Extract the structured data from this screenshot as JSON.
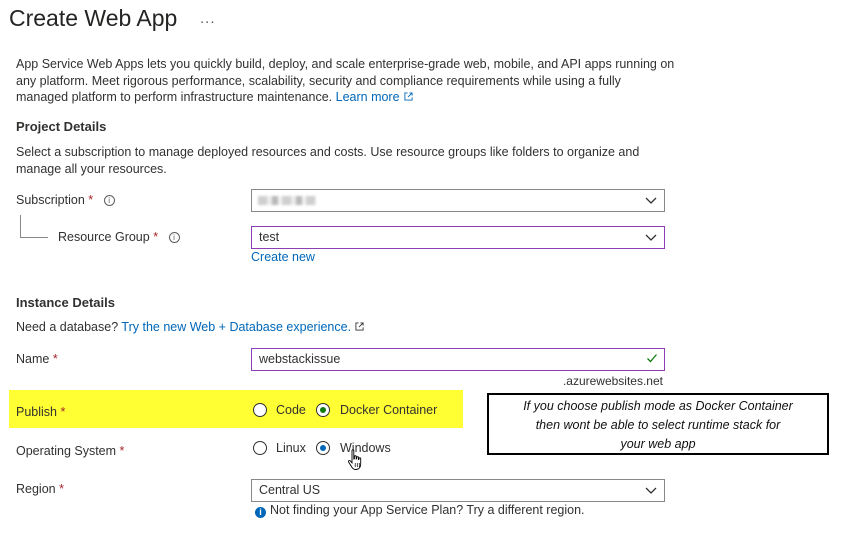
{
  "page": {
    "title": "Create Web App",
    "more_menu": "...",
    "intro": "App Service Web Apps lets you quickly build, deploy, and scale enterprise-grade web, mobile, and API apps running on any platform. Meet rigorous performance, scalability, security and compliance requirements while using a fully managed platform to perform infrastructure maintenance.",
    "learn_more": "Learn more"
  },
  "project": {
    "heading": "Project Details",
    "description": "Select a subscription to manage deployed resources and costs. Use resource groups like folders to organize and manage all your resources.",
    "subscription_label": "Subscription",
    "subscription_value": "",
    "resource_group_label": "Resource Group",
    "resource_group_value": "test",
    "create_new": "Create new"
  },
  "instance": {
    "heading": "Instance Details",
    "db_prompt": "Need a database?",
    "db_link": "Try the new Web + Database experience.",
    "name_label": "Name",
    "name_value": "webstackissue",
    "name_suffix": ".azurewebsites.net",
    "publish_label": "Publish",
    "publish_options": [
      "Code",
      "Docker Container"
    ],
    "publish_selected": "Docker Container",
    "os_label": "Operating System",
    "os_options": [
      "Linux",
      "Windows"
    ],
    "os_selected": "Windows",
    "region_label": "Region",
    "region_value": "Central US",
    "region_hint": "Not finding your App Service Plan? Try a different region."
  },
  "annotation": {
    "lines": [
      "If you choose publish mode as Docker Container",
      "then wont be able to select runtime stack for",
      "your web app"
    ]
  },
  "colors": {
    "link": "#0067b8",
    "required": "#a4262c",
    "highlight": "#ffff33",
    "focus_border": "#8c3fb5",
    "valid_check": "#107c10"
  }
}
